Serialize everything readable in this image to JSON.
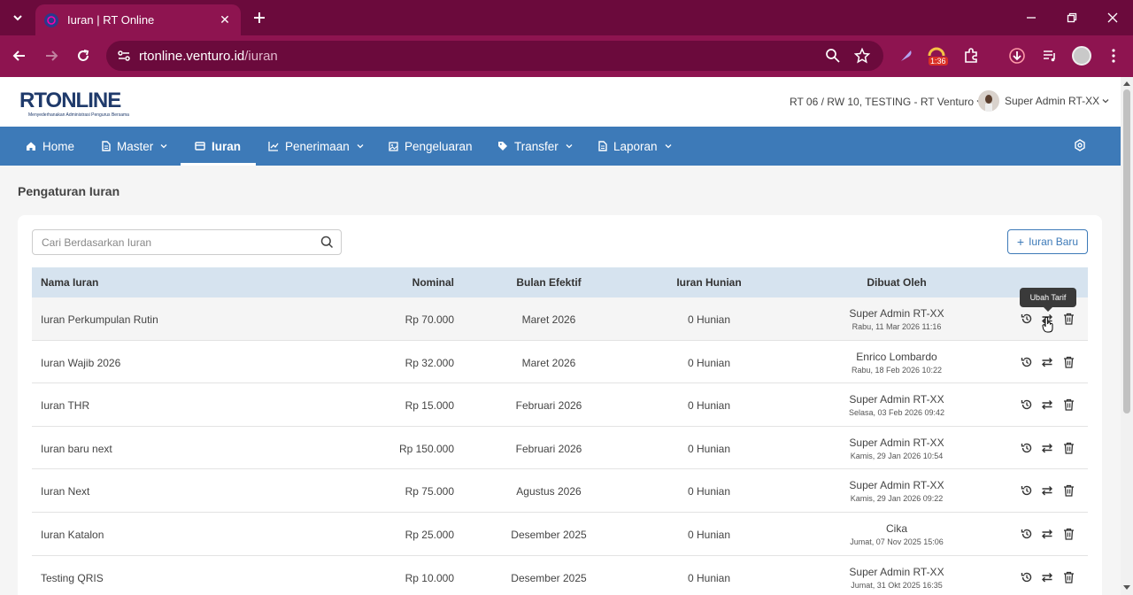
{
  "browser": {
    "tab_title": "Iuran | RT Online",
    "url_host": "rtonline.venturo.id",
    "url_path": "/iuran",
    "extension_badge": "1:36"
  },
  "app": {
    "logo_text": "RTONLINE",
    "logo_tagline": "Menyederhanakan Administrasi Pengurus Bersama",
    "context": "RT 06 / RW 10, TESTING - RT Venturo",
    "user_name": "Super Admin RT-XX"
  },
  "nav": [
    {
      "label": "Home",
      "icon": "home-icon",
      "dropdown": false
    },
    {
      "label": "Master",
      "icon": "document-icon",
      "dropdown": true
    },
    {
      "label": "Iuran",
      "icon": "card-icon",
      "dropdown": false,
      "active": true
    },
    {
      "label": "Penerimaan",
      "icon": "chart-icon",
      "dropdown": true
    },
    {
      "label": "Pengeluaran",
      "icon": "image-icon",
      "dropdown": false
    },
    {
      "label": "Transfer",
      "icon": "tag-icon",
      "dropdown": true
    },
    {
      "label": "Laporan",
      "icon": "document-icon",
      "dropdown": true
    }
  ],
  "page": {
    "title": "Pengaturan Iuran",
    "search_placeholder": "Cari Berdasarkan Iuran",
    "add_button": "Iuran Baru",
    "tooltip": "Ubah Tarif"
  },
  "table": {
    "headers": {
      "name": "Nama Iuran",
      "nominal": "Nominal",
      "bulan": "Bulan Efektif",
      "hunian": "Iuran Hunian",
      "by": "Dibuat Oleh"
    },
    "rows": [
      {
        "name": "Iuran Perkumpulan Rutin",
        "nominal": "Rp 70.000",
        "bulan": "Maret 2026",
        "hunian": "0 Hunian",
        "by": "Super Admin RT-XX",
        "date": "Rabu, 11 Mar 2026 11:16"
      },
      {
        "name": "Iuran Wajib 2026",
        "nominal": "Rp 32.000",
        "bulan": "Maret 2026",
        "hunian": "0 Hunian",
        "by": "Enrico Lombardo",
        "date": "Rabu, 18 Feb 2026 10:22"
      },
      {
        "name": "Iuran THR",
        "nominal": "Rp 15.000",
        "bulan": "Februari 2026",
        "hunian": "0 Hunian",
        "by": "Super Admin RT-XX",
        "date": "Selasa, 03 Feb 2026 09:42"
      },
      {
        "name": "Iuran baru next",
        "nominal": "Rp 150.000",
        "bulan": "Februari 2026",
        "hunian": "0 Hunian",
        "by": "Super Admin RT-XX",
        "date": "Kamis, 29 Jan 2026 10:54"
      },
      {
        "name": "Iuran Next",
        "nominal": "Rp 75.000",
        "bulan": "Agustus 2026",
        "hunian": "0 Hunian",
        "by": "Super Admin RT-XX",
        "date": "Kamis, 29 Jan 2026 09:22"
      },
      {
        "name": "Iuran Katalon",
        "nominal": "Rp 25.000",
        "bulan": "Desember 2025",
        "hunian": "0 Hunian",
        "by": "Cika",
        "date": "Jumat, 07 Nov 2025 15:06"
      },
      {
        "name": "Testing QRIS",
        "nominal": "Rp 10.000",
        "bulan": "Desember 2025",
        "hunian": "0 Hunian",
        "by": "Super Admin RT-XX",
        "date": "Jumat, 31 Okt 2025 16:35"
      }
    ]
  },
  "colors": {
    "chrome": "#8e1450",
    "chrome_dark": "#6b0a3c",
    "nav": "#3d7ab8",
    "table_header": "#d6e3ef"
  }
}
